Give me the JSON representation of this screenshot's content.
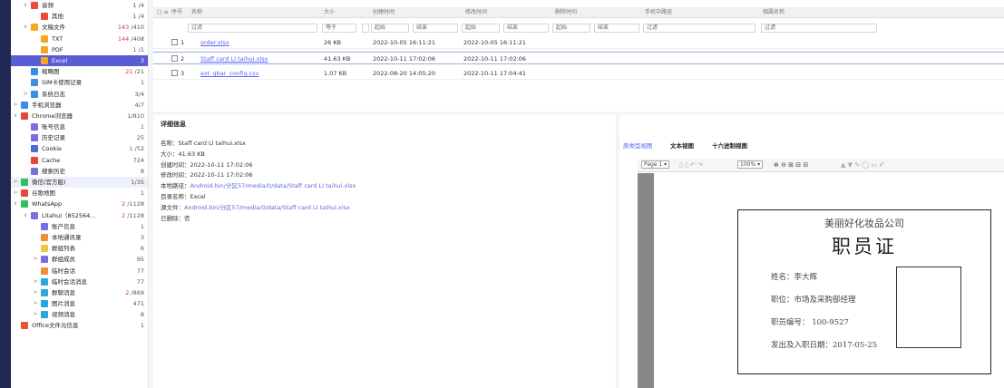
{
  "sidebar": {
    "items": [
      {
        "label": "音频",
        "count": "1 /4",
        "indent": 2,
        "chev": "∨",
        "color": "#e94b3c"
      },
      {
        "label": "其他",
        "count": "1 /4",
        "indent": 3,
        "chev": "",
        "color": "#e94b3c"
      },
      {
        "label": "文稿文件",
        "count": "143 /410",
        "countRed": "143",
        "indent": 2,
        "chev": "∨",
        "color": "#f5a623"
      },
      {
        "label": "TXT",
        "count": "144 /408",
        "countRed": "144",
        "indent": 3,
        "chev": "",
        "color": "#f5a623"
      },
      {
        "label": "PDF",
        "count": "1 /1",
        "countRed": "1",
        "indent": 3,
        "chev": "",
        "color": "#f5a623"
      },
      {
        "label": "Excel",
        "count": "3",
        "indent": 3,
        "chev": "",
        "color": "#f5a623",
        "selected": true
      },
      {
        "label": "缩略图",
        "count": "21 /21",
        "countRed": "21",
        "indent": 2,
        "chev": "",
        "color": "#3a8ee6"
      },
      {
        "label": "SIM卡使用记录",
        "count": "1",
        "indent": 2,
        "chev": "",
        "color": "#3a8ee6"
      },
      {
        "label": "系统日志",
        "count": "3/4",
        "indent": 2,
        "chev": ">",
        "color": "#3a8ee6"
      },
      {
        "label": "手机浏览器",
        "count": "4/7",
        "indent": 1,
        "chev": ">",
        "color": "#3a8ee6"
      },
      {
        "label": "Chrome浏览器",
        "count": "1/810",
        "indent": 1,
        "chev": "∨",
        "color": "#e8453c"
      },
      {
        "label": "账号信息",
        "count": "1",
        "indent": 2,
        "chev": "",
        "color": "#7b6fe0"
      },
      {
        "label": "历史记录",
        "count": "25",
        "indent": 2,
        "chev": "",
        "color": "#7b6fe0"
      },
      {
        "label": "Cookie",
        "count": "1 /52",
        "countRed": "1",
        "indent": 2,
        "chev": "",
        "color": "#4a6fd1"
      },
      {
        "label": "Cache",
        "count": "724",
        "indent": 2,
        "chev": "",
        "color": "#e8453c"
      },
      {
        "label": "搜索历史",
        "count": "8",
        "indent": 2,
        "chev": "",
        "color": "#7b6fe0"
      },
      {
        "label": "微信(官方版)",
        "count": "1/35",
        "indent": 1,
        "chev": ">",
        "color": "#2ec05c",
        "hl": true
      },
      {
        "label": "谷歌地图",
        "count": "1",
        "indent": 1,
        "chev": ">",
        "color": "#e8453c"
      },
      {
        "label": "WhatsApp",
        "count": "2 /1128",
        "countRed": "2",
        "indent": 1,
        "chev": "∨",
        "color": "#2ec05c"
      },
      {
        "label": "Litahui（852564...",
        "count": "2 /1128",
        "countRed": "2",
        "indent": 2,
        "chev": "∨",
        "color": "#7b6fe0"
      },
      {
        "label": "账户信息",
        "count": "1",
        "indent": 3,
        "chev": "",
        "color": "#7b6fe0"
      },
      {
        "label": "本地通讯录",
        "count": "3",
        "indent": 3,
        "chev": "",
        "color": "#f08c3c"
      },
      {
        "label": "群组列表",
        "count": "6",
        "indent": 3,
        "chev": "",
        "color": "#f5c242"
      },
      {
        "label": "群组成员",
        "count": "95",
        "indent": 3,
        "chev": ">",
        "color": "#7b6fe0"
      },
      {
        "label": "临时会话",
        "count": "77",
        "indent": 3,
        "chev": "",
        "color": "#f08c3c"
      },
      {
        "label": "临时会话消息",
        "count": "77",
        "indent": 3,
        "chev": ">",
        "color": "#2aa8d8"
      },
      {
        "label": "群聊消息",
        "count": "2 /869",
        "countRed": "2",
        "indent": 3,
        "chev": ">",
        "color": "#2aa8d8"
      },
      {
        "label": "图片消息",
        "count": "471",
        "indent": 3,
        "chev": ">",
        "color": "#2aa8d8"
      },
      {
        "label": "视频消息",
        "count": "8",
        "indent": 3,
        "chev": ">",
        "color": "#2aa8d8"
      },
      {
        "label": "Office文件元信息",
        "count": "1",
        "indent": 1,
        "chev": "",
        "color": "#e8542b"
      }
    ]
  },
  "table": {
    "headers": [
      "序号",
      "名称",
      "大小",
      "创建时间",
      "修改时间",
      "删除时间",
      "手机中路径",
      "相属名称"
    ],
    "filter": {
      "placeholder": "过滤",
      "equals": "等于",
      "start": "起始",
      "end": "结束"
    },
    "rows": [
      {
        "idx": "1",
        "name": "order.xlsx",
        "size": "26 KB",
        "created": "2022-10-05 16:11:21",
        "modified": "2022-10-05 16:11:21"
      },
      {
        "idx": "2",
        "name": "Staff card LI taihui.xlsx",
        "size": "41.63 KB",
        "created": "2022-10-11 17:02:06",
        "modified": "2022-10-11 17:02:06"
      },
      {
        "idx": "3",
        "name": "ext_gbar_config.csv",
        "size": "1.07 KB",
        "created": "2022-08-20 14:05:20",
        "modified": "2022-10-11 17:04:41"
      }
    ]
  },
  "detail": {
    "title": "详细信息",
    "lines": [
      {
        "k": "名称：",
        "v": "Staff card LI taihui.xlsx",
        "link": false
      },
      {
        "k": "大小：",
        "v": "41.63 KB",
        "link": false
      },
      {
        "k": "创建时间：",
        "v": "2022-10-11 17:02:06",
        "link": false
      },
      {
        "k": "修改时间：",
        "v": "2022-10-11 17:02:06",
        "link": false
      },
      {
        "k": "本地路径：",
        "v": "Android.bin/分区57/media/0/data/Staff card LI taihui.xlsx",
        "link": true
      },
      {
        "k": "目录名称：",
        "v": "Excel",
        "link": false
      },
      {
        "k": "源文件：",
        "v": "Android.bin/分区57/media/0/data/Staff card LI taihui.xlsx",
        "link": true
      },
      {
        "k": "已删除：",
        "v": "否",
        "link": false
      }
    ]
  },
  "preview": {
    "tabs": [
      "原类型视图",
      "文本视图",
      "十六进制视图"
    ],
    "page": "Page 1",
    "zoom": "100%",
    "card": {
      "company": "美丽好化妆品公司",
      "title": "职员证",
      "name": "姓名：李大辉",
      "position": "职位：市场及采购部经理",
      "number": "职员编号： 100-9527",
      "date": "发出及入职日期：2017-05-25"
    }
  }
}
